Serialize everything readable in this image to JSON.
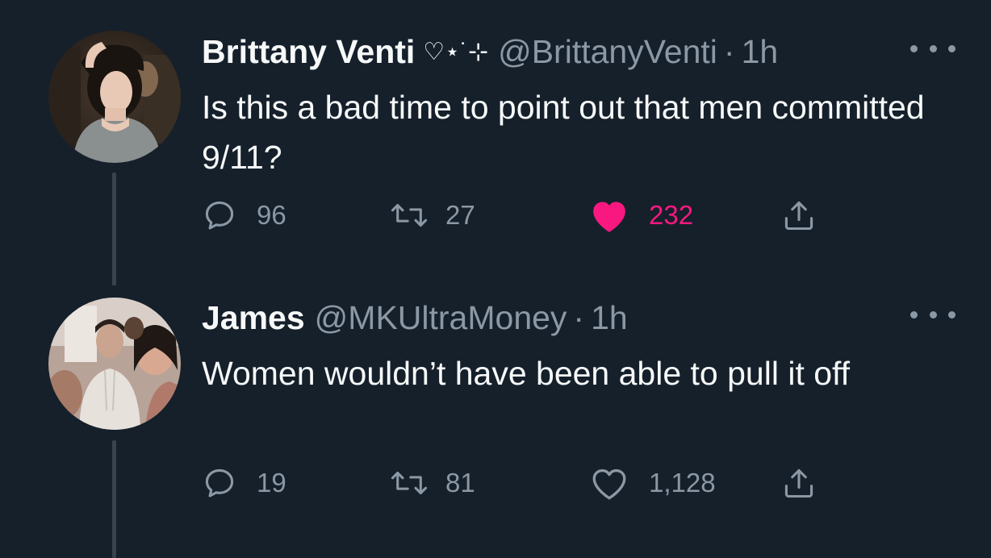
{
  "tweets": [
    {
      "name": "Brittany Venti",
      "name_decoration": "♡⋆˙⊹",
      "handle": "@BrittanyVenti",
      "separator": "·",
      "time": "1h",
      "text": "Is this a bad time to point out that men committed 9/11?",
      "replies": "96",
      "retweets": "27",
      "likes": "232",
      "liked": true,
      "icons": [
        "reply-icon",
        "retweet-icon",
        "heart-filled-icon",
        "share-icon",
        "more-icon"
      ]
    },
    {
      "name": "James",
      "handle": "@MKUltraMoney",
      "separator": "·",
      "time": "1h",
      "text": "Women wouldn’t have been able to pull it off",
      "replies": "19",
      "retweets": "81",
      "likes": "1,128",
      "liked": false,
      "icons": [
        "reply-icon",
        "retweet-icon",
        "heart-outline-icon",
        "share-icon",
        "more-icon"
      ]
    }
  ],
  "colors": {
    "background": "#15202b",
    "primary_text": "#f7f9f9",
    "secondary_text": "#8b98a5",
    "like_active": "#f91880",
    "thread_line": "#38444d"
  }
}
